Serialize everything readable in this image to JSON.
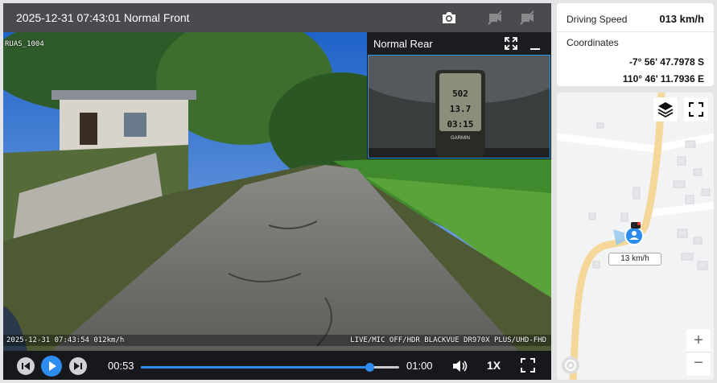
{
  "player": {
    "title": "2025-12-31 07:43:01 Normal Front",
    "icons": [
      "camera-icon",
      "hide-front-icon",
      "hide-rear-icon"
    ]
  },
  "video": {
    "osd_top_left": "RUAS_1004",
    "osd_bottom_left": "2025-12-31 07:43:54 012km/h",
    "osd_bottom_right": "LIVE/MIC OFF/HDR BLACKVUE DR970X PLUS/UHD-FHD"
  },
  "pip": {
    "label": "Normal Rear",
    "gps_readout": [
      "502",
      "13.7",
      "03:15"
    ],
    "gps_brand": "GARMIN"
  },
  "controls": {
    "current_time": "00:53",
    "total_time": "01:00",
    "progress": 0.8833,
    "speed_label": "1X"
  },
  "info": {
    "speed_label": "Driving Speed",
    "speed_value": "013 km/h",
    "coords_label": "Coordinates",
    "lat": "-7° 56' 47.7978 S",
    "lon": "110° 46' 11.7936 E"
  },
  "map": {
    "speed_tag": "13 km/h",
    "zoom_in": "+",
    "zoom_out": "−"
  },
  "colors": {
    "accent": "#2d8cf0",
    "topbar": "#4a4b4e",
    "road": "#f6d79a"
  }
}
